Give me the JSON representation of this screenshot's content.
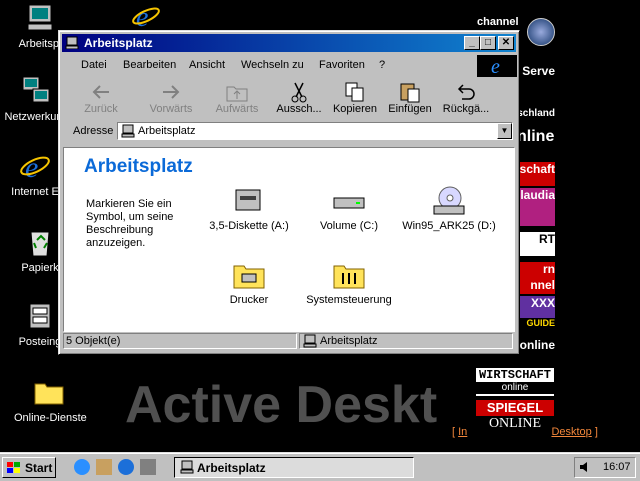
{
  "desktop": {
    "icons": [
      {
        "label": "Arbeitspl"
      },
      {
        "label": "Netzwerkum"
      },
      {
        "label": "Internet E"
      },
      {
        "label": "Papierk"
      },
      {
        "label": "Posteing"
      },
      {
        "label": "Online-Dienste"
      }
    ],
    "watermark": "Active Deskt",
    "channel_title": "channel",
    "channels": [
      "Serve",
      "schland",
      "nline-",
      "schaft",
      "laudia",
      "RT",
      "rn",
      "nnel",
      "XXX",
      "GUIDE",
      "online"
    ],
    "wirtschaft": "WIRTSCHAFT",
    "wirtschaft_sub": "online",
    "spiegel": "SPIEGEL",
    "spiegel_sub": "ONLINE",
    "links_left": "In",
    "links_right": "Desktop"
  },
  "window": {
    "title": "Arbeitsplatz",
    "menu": [
      "Datei",
      "Bearbeiten",
      "Ansicht",
      "Wechseln zu",
      "Favoriten",
      "?"
    ],
    "toolbar": [
      {
        "label": "Zurück",
        "enabled": false
      },
      {
        "label": "Vorwärts",
        "enabled": false
      },
      {
        "label": "Aufwärts",
        "enabled": false
      },
      {
        "label": "Aussch...",
        "enabled": true
      },
      {
        "label": "Kopieren",
        "enabled": true
      },
      {
        "label": "Einfügen",
        "enabled": true
      },
      {
        "label": "Rückgä...",
        "enabled": true
      }
    ],
    "address_label": "Adresse",
    "address_value": "Arbeitsplatz",
    "content_title": "Arbeitsplatz",
    "content_desc": "Markieren Sie ein Symbol, um seine Beschreibung anzuzeigen.",
    "items": [
      {
        "label": "3,5-Diskette (A:)"
      },
      {
        "label": "Volume (C:)"
      },
      {
        "label": "Win95_ARK25 (D:)"
      },
      {
        "label": "Drucker"
      },
      {
        "label": "Systemsteuerung"
      }
    ],
    "status_count": "5 Objekt(e)",
    "status_location": "Arbeitsplatz"
  },
  "taskbar": {
    "start": "Start",
    "task_button": "Arbeitsplatz",
    "time": "16:07"
  },
  "colors": {
    "title_start": "#000080",
    "title_end": "#1084d0",
    "accent": "#0b6ad8"
  }
}
